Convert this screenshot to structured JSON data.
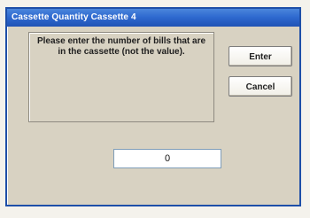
{
  "window": {
    "title": "Cassette Quantity  Cassette 4"
  },
  "message": {
    "text": "Please enter the number of bills that are in the cassette (not the value)."
  },
  "buttons": {
    "enter_label": "Enter",
    "cancel_label": "Cancel"
  },
  "input": {
    "value": "0"
  }
}
